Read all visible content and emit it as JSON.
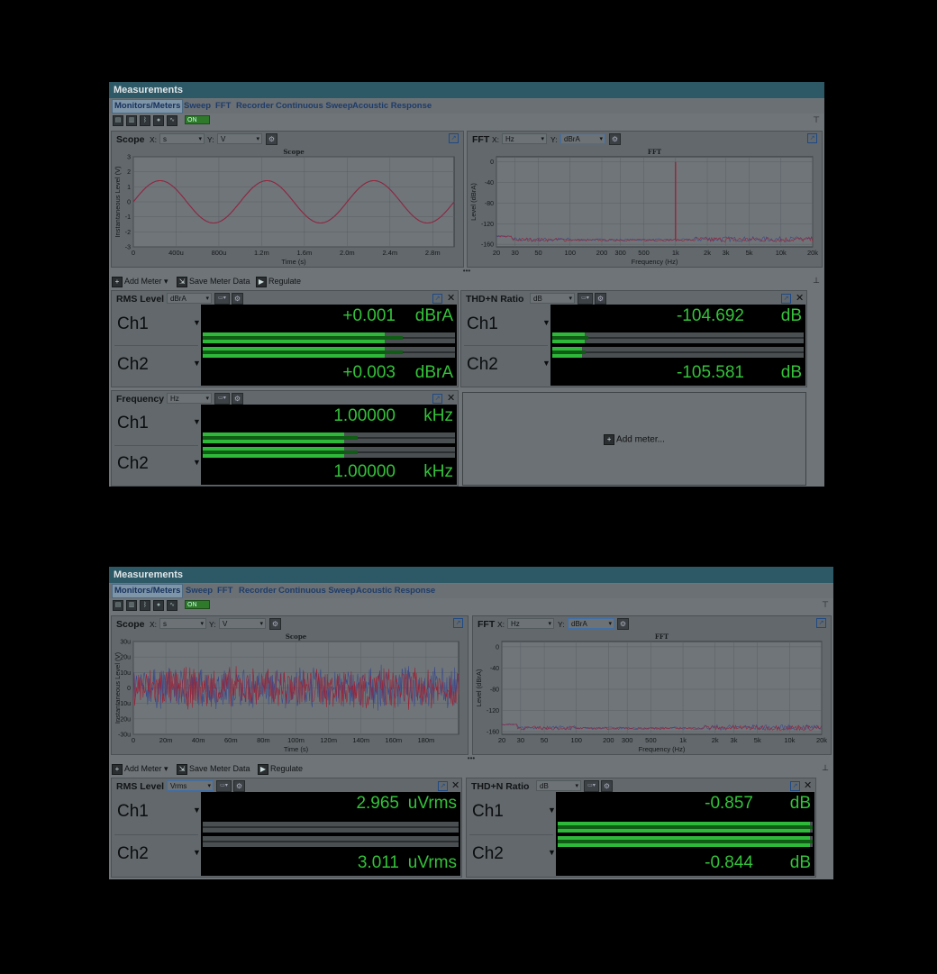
{
  "screens": [
    {
      "window_title": "Measurements",
      "tabs": [
        "Monitors/Meters",
        "Sweep",
        "FFT",
        "Recorder",
        "Continuous Sweep",
        "Acoustic Response"
      ],
      "toolbar": {
        "on_label": "ON"
      },
      "scope": {
        "title": "Scope",
        "x_label": "X:",
        "x_unit": "s",
        "y_label": "Y:",
        "y_unit": "V",
        "chart_data": {
          "type": "line",
          "title": "Scope",
          "xlabel": "Time (s)",
          "ylabel": "Instantaneous Level (V)",
          "xticks": [
            "0",
            "400u",
            "800u",
            "1.2m",
            "1.6m",
            "2.0m",
            "2.4m",
            "2.8m"
          ],
          "yticks": [
            "3",
            "2",
            "1",
            "0",
            "-1",
            "-2",
            "-3"
          ],
          "xlim": [
            0,
            0.003
          ],
          "ylim": [
            -3,
            3
          ],
          "series": [
            {
              "waveform": "sine",
              "amplitude": 1.41,
              "frequency_hz": 1000
            }
          ]
        }
      },
      "fft": {
        "title": "FFT",
        "x_label": "X:",
        "x_unit": "Hz",
        "y_label": "Y:",
        "y_unit": "dBrA",
        "chart_data": {
          "type": "line",
          "title": "FFT",
          "xlabel": "Frequency (Hz)",
          "ylabel": "Level (dBrA)",
          "xticks": [
            "20",
            "30",
            "50",
            "100",
            "200",
            "300",
            "500",
            "1k",
            "2k",
            "3k",
            "5k",
            "10k",
            "20k"
          ],
          "yticks": [
            "0",
            "-40",
            "-80",
            "-120",
            "-160"
          ],
          "xlim": [
            20,
            20000
          ],
          "ylim": [
            -165,
            10
          ],
          "xscale": "log",
          "series": [
            {
              "type": "noise_floor",
              "level": -152,
              "peaks": [
                {
                  "x": 1000,
                  "y": 0
                }
              ]
            }
          ]
        }
      },
      "meter_toolbar": {
        "add": "Add Meter",
        "save": "Save Meter Data",
        "regulate": "Regulate"
      },
      "meters": [
        {
          "title": "RMS Level",
          "unit_select": "dBrA",
          "channels": [
            {
              "name": "Ch1",
              "value": "+0.001",
              "unit": "dBrA",
              "level": 0.72
            },
            {
              "name": "Ch2",
              "value": "+0.003",
              "unit": "dBrA",
              "level": 0.72
            }
          ]
        },
        {
          "title": "THD+N Ratio",
          "unit_select": "dB",
          "channels": [
            {
              "name": "Ch1",
              "value": "-104.692",
              "unit": "dB",
              "level": 0.13
            },
            {
              "name": "Ch2",
              "value": "-105.581",
              "unit": "dB",
              "level": 0.12
            }
          ]
        },
        {
          "title": "Frequency",
          "unit_select": "Hz",
          "channels": [
            {
              "name": "Ch1",
              "value": "1.00000",
              "unit": "kHz",
              "level": 0.56
            },
            {
              "name": "Ch2",
              "value": "1.00000",
              "unit": "kHz",
              "level": 0.56
            }
          ]
        }
      ],
      "add_meter_label": "Add meter..."
    },
    {
      "window_title": "Measurements",
      "tabs": [
        "Monitors/Meters",
        "Sweep",
        "FFT",
        "Recorder",
        "Continuous Sweep",
        "Acoustic Response"
      ],
      "toolbar": {
        "on_label": "ON"
      },
      "scope": {
        "title": "Scope",
        "x_label": "X:",
        "x_unit": "s",
        "y_label": "Y:",
        "y_unit": "V",
        "chart_data": {
          "type": "line",
          "title": "Scope",
          "xlabel": "Time (s)",
          "ylabel": "Instantaneous Level (V)",
          "xticks": [
            "0",
            "20m",
            "40m",
            "60m",
            "80m",
            "100m",
            "120m",
            "140m",
            "160m",
            "180m"
          ],
          "yticks": [
            "30u",
            "20u",
            "10u",
            "0",
            "-10u",
            "-20u",
            "-30u"
          ],
          "xlim": [
            0,
            0.2
          ],
          "ylim": [
            -3e-05,
            3e-05
          ],
          "series": [
            {
              "waveform": "noise",
              "amplitude": 1e-05
            }
          ]
        }
      },
      "fft": {
        "title": "FFT",
        "x_label": "X:",
        "x_unit": "Hz",
        "y_label": "Y:",
        "y_unit": "dBrA",
        "chart_data": {
          "type": "line",
          "title": "FFT",
          "xlabel": "Frequency (Hz)",
          "ylabel": "Level (dBrA)",
          "xticks": [
            "20",
            "30",
            "50",
            "100",
            "200",
            "300",
            "500",
            "1k",
            "2k",
            "3k",
            "5k",
            "10k",
            "20k"
          ],
          "yticks": [
            "0",
            "-40",
            "-80",
            "-120",
            "-160"
          ],
          "xlim": [
            20,
            20000
          ],
          "ylim": [
            -165,
            10
          ],
          "xscale": "log",
          "series": [
            {
              "type": "noise_floor",
              "level": -154,
              "peaks": []
            }
          ]
        }
      },
      "meter_toolbar": {
        "add": "Add Meter",
        "save": "Save Meter Data",
        "regulate": "Regulate"
      },
      "meters": [
        {
          "title": "RMS Level",
          "unit_select": "Vrms",
          "channels": [
            {
              "name": "Ch1",
              "value": "2.965",
              "unit": "uVrms",
              "level": 0.0
            },
            {
              "name": "Ch2",
              "value": "3.011",
              "unit": "uVrms",
              "level": 0.0
            }
          ]
        },
        {
          "title": "THD+N Ratio",
          "unit_select": "dB",
          "channels": [
            {
              "name": "Ch1",
              "value": "-0.857",
              "unit": "dB",
              "level": 0.99
            },
            {
              "name": "Ch2",
              "value": "-0.844",
              "unit": "dB",
              "level": 0.99
            }
          ]
        }
      ]
    }
  ],
  "colors": {
    "ch1": "#3b4a8a",
    "ch2": "#9a2438",
    "meter_text": "#34c23a",
    "meter_fill": "#2fb93a"
  }
}
